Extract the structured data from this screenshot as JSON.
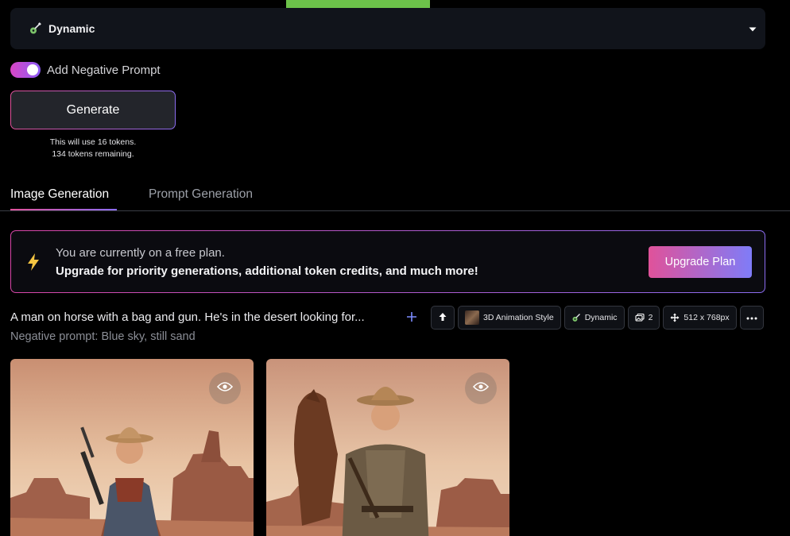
{
  "style_select": {
    "label": "Dynamic",
    "icon": "guitar-icon"
  },
  "negative_prompt_toggle": {
    "label": "Add Negative Prompt",
    "on": true
  },
  "generate": {
    "label": "Generate",
    "token_line1": "This will use 16 tokens.",
    "token_line2": "134 tokens remaining."
  },
  "tabs": [
    {
      "label": "Image Generation",
      "active": true
    },
    {
      "label": "Prompt Generation",
      "active": false
    }
  ],
  "banner": {
    "line1": "You are currently on a free plan.",
    "line2": "Upgrade for priority generations, additional token credits, and much more!",
    "button": "Upgrade Plan",
    "icon": "lightning-icon"
  },
  "generation": {
    "prompt": "A man on horse with a bag and gun. He's in the desert looking for...",
    "negative_prompt": "Negative prompt: Blue sky, still sand",
    "chips": {
      "style": "3D Animation Style",
      "mode": "Dynamic",
      "count": "2",
      "size": "512 x 768px"
    }
  },
  "colors": {
    "accent_pink": "#e0529a",
    "accent_purple": "#8b6cf0",
    "green_tab": "#6cc24a"
  }
}
